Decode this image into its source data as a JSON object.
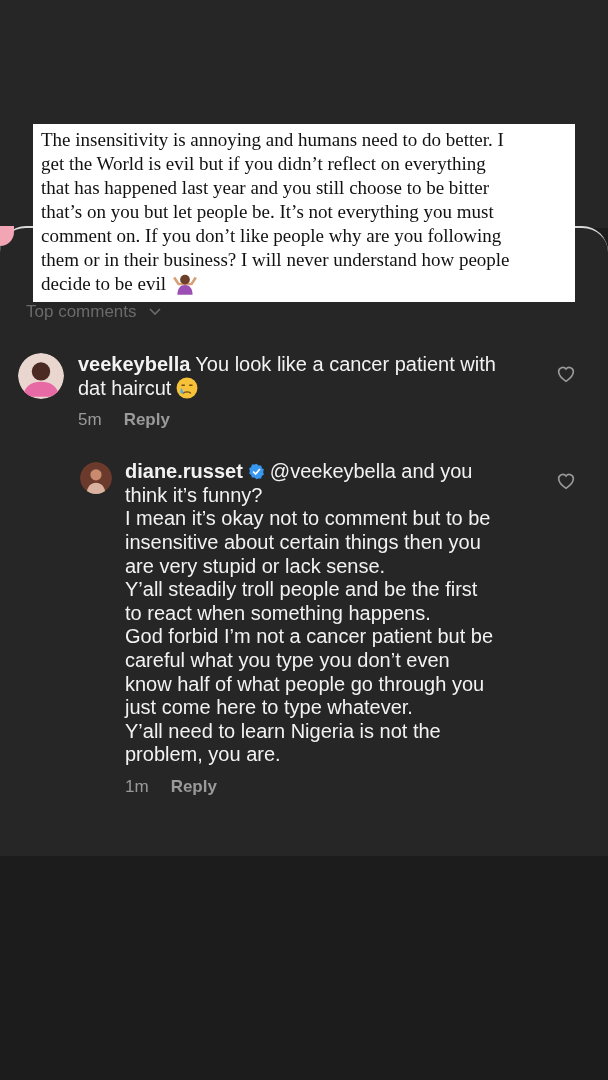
{
  "note": {
    "lines": [
      "The insensitivity is annoying and humans need to do better. I",
      "get the World is evil but if you didn’t reflect on everything",
      "that has happened last year and you still choose to be bitter",
      "that’s on you but let people be. It’s not everything you must",
      "comment on. If you don’t like people why are you following",
      "them or in their business? I will never understand how people",
      "decide to be evil"
    ]
  },
  "section_title": "Top comments",
  "comments": [
    {
      "username": "veekeybella",
      "verified": false,
      "lines": [
        "You look like a cancer patient with",
        "dat haircut"
      ],
      "time": "5m",
      "reply": "Reply",
      "kind": "comment"
    },
    {
      "username": "diane.russet",
      "verified": true,
      "lines": [
        "@veekeybella and you",
        "think it’s funny?",
        "I mean it’s okay not to comment but to be",
        "insensitive about certain things then you",
        "are very stupid or lack sense.",
        "Y’all steadily troll people and be the first",
        "to react when something happens.",
        "God forbid I’m not a cancer patient but be",
        "careful what you type you don’t even",
        "know half of what people go through you",
        "just come here to type whatever.",
        "Y’all need to learn Nigeria is not the",
        "problem, you are."
      ],
      "time": "1m",
      "reply": "Reply",
      "kind": "reply"
    }
  ]
}
